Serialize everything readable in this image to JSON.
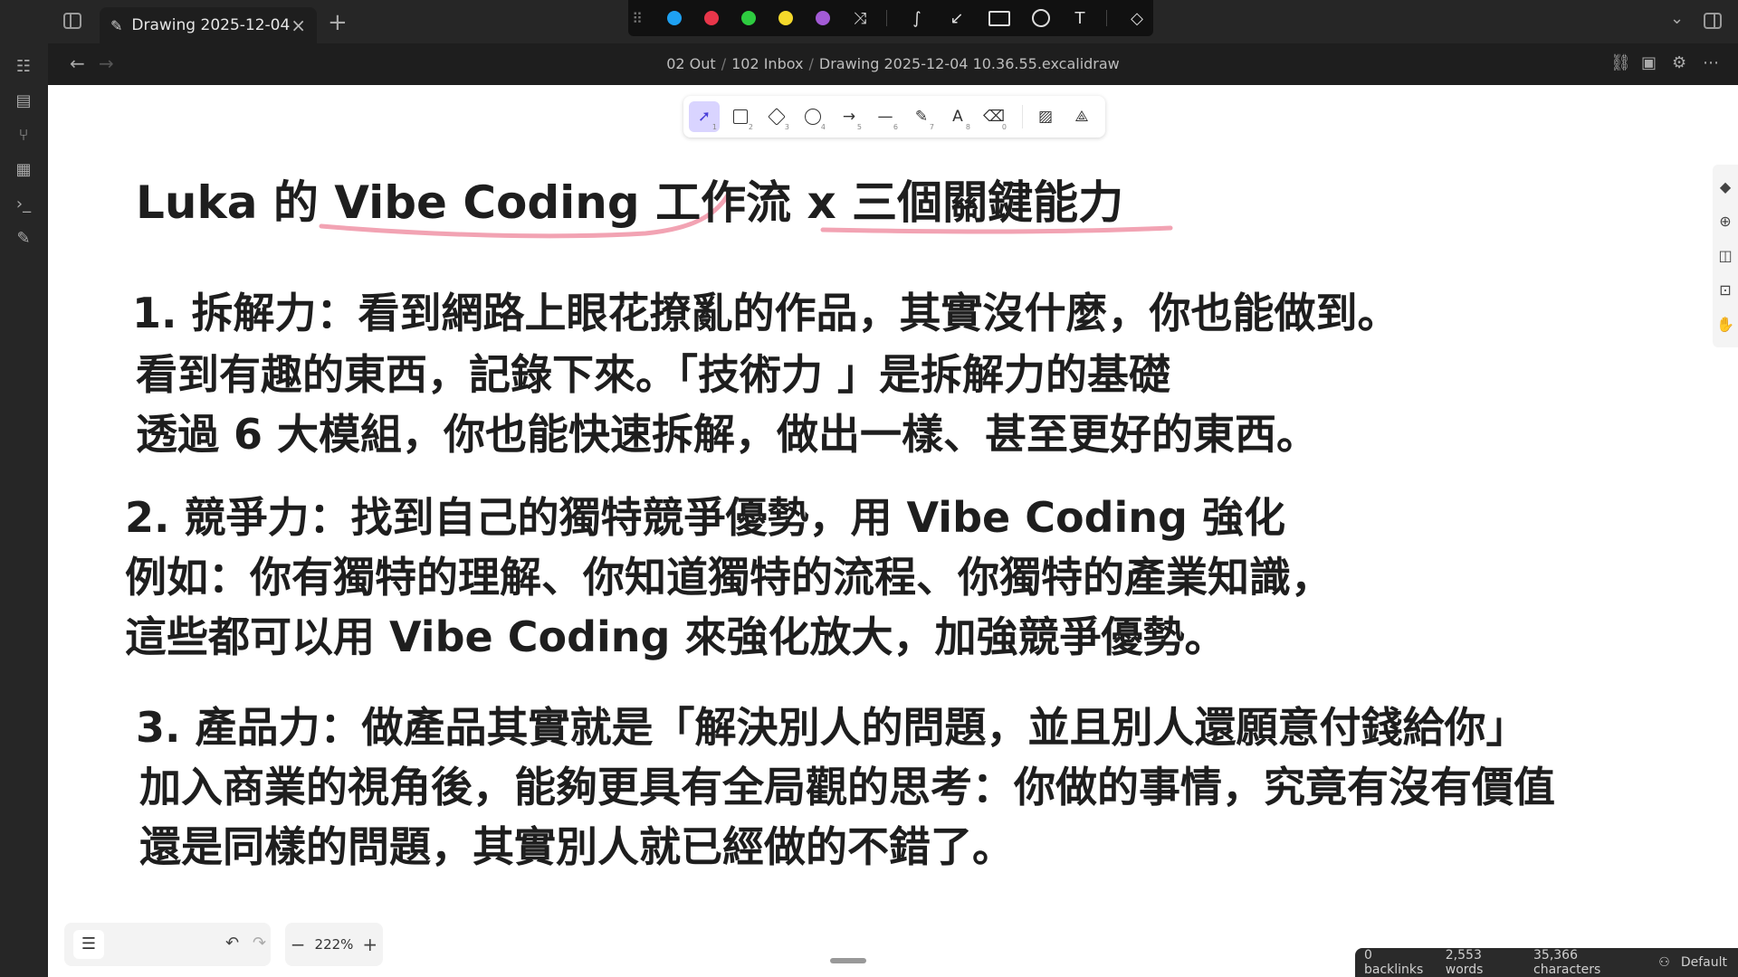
{
  "tab": {
    "title": "Drawing 2025-12-04 ...",
    "close": "×",
    "add": "+"
  },
  "color_toolbar": {
    "grip": "⠿",
    "colors": [
      "#1ea1f2",
      "#e8364a",
      "#2ecc40",
      "#f4d92b",
      "#a35bd6"
    ],
    "icons": [
      "shuffle-icon",
      "curve-icon",
      "arrow-icon",
      "rectangle-icon",
      "circle-icon",
      "text-icon",
      "eraser-icon"
    ]
  },
  "header": {
    "breadcrumb": [
      "02 Out",
      "102 Inbox",
      "Drawing 2025-12-04 10.36.55.excalidraw"
    ],
    "sep": "/",
    "back": "←",
    "forward": "→"
  },
  "excalidraw_toolbar": {
    "tools": [
      {
        "name": "selection-tool",
        "num": "1",
        "active": true
      },
      {
        "name": "rectangle-tool",
        "num": "2"
      },
      {
        "name": "diamond-tool",
        "num": "3"
      },
      {
        "name": "ellipse-tool",
        "num": "4"
      },
      {
        "name": "arrow-tool",
        "num": "5"
      },
      {
        "name": "line-tool",
        "num": "6"
      },
      {
        "name": "draw-tool",
        "num": "7"
      },
      {
        "name": "text-tool",
        "num": "8"
      },
      {
        "name": "eraser-tool",
        "num": "0"
      }
    ]
  },
  "drawing": {
    "title": "Luka 的 Vibe Coding 工作流 x 三個關鍵能力",
    "section1": [
      "1. 拆解力：看到網路上眼花撩亂的作品，其實沒什麼，你也能做到。",
      "看到有趣的東西，記錄下來。「技術力 」是拆解力的基礎",
      "透過 6 大模組，你也能快速拆解，做出一樣、甚至更好的東西。"
    ],
    "section2": [
      "2. 競爭力：找到自己的獨特競爭優勢，用 Vibe Coding 強化",
      "例如：你有獨特的理解、你知道獨特的流程、你獨特的產業知識，",
      "這些都可以用 Vibe Coding 來強化放大，加強競爭優勢。"
    ],
    "section3": [
      "3. 產品力：做產品其實就是「解決別人的問題，並且別人還願意付錢給你」",
      "加入商業的視角後，能夠更具有全局觀的思考：你做的事情，究竟有沒有價值",
      "還是同樣的問題，其實別人就已經做的不錯了。"
    ],
    "underline_color": "#f2a3b3"
  },
  "zoom": {
    "value": "222%",
    "minus": "−",
    "plus": "+"
  },
  "bottom_tools": {
    "menu": "☰",
    "undo": "↶",
    "redo": "↷"
  },
  "status": {
    "backlinks": "0 backlinks",
    "words": "2,553 words",
    "characters": "35,366 characters",
    "mode": "Default"
  }
}
